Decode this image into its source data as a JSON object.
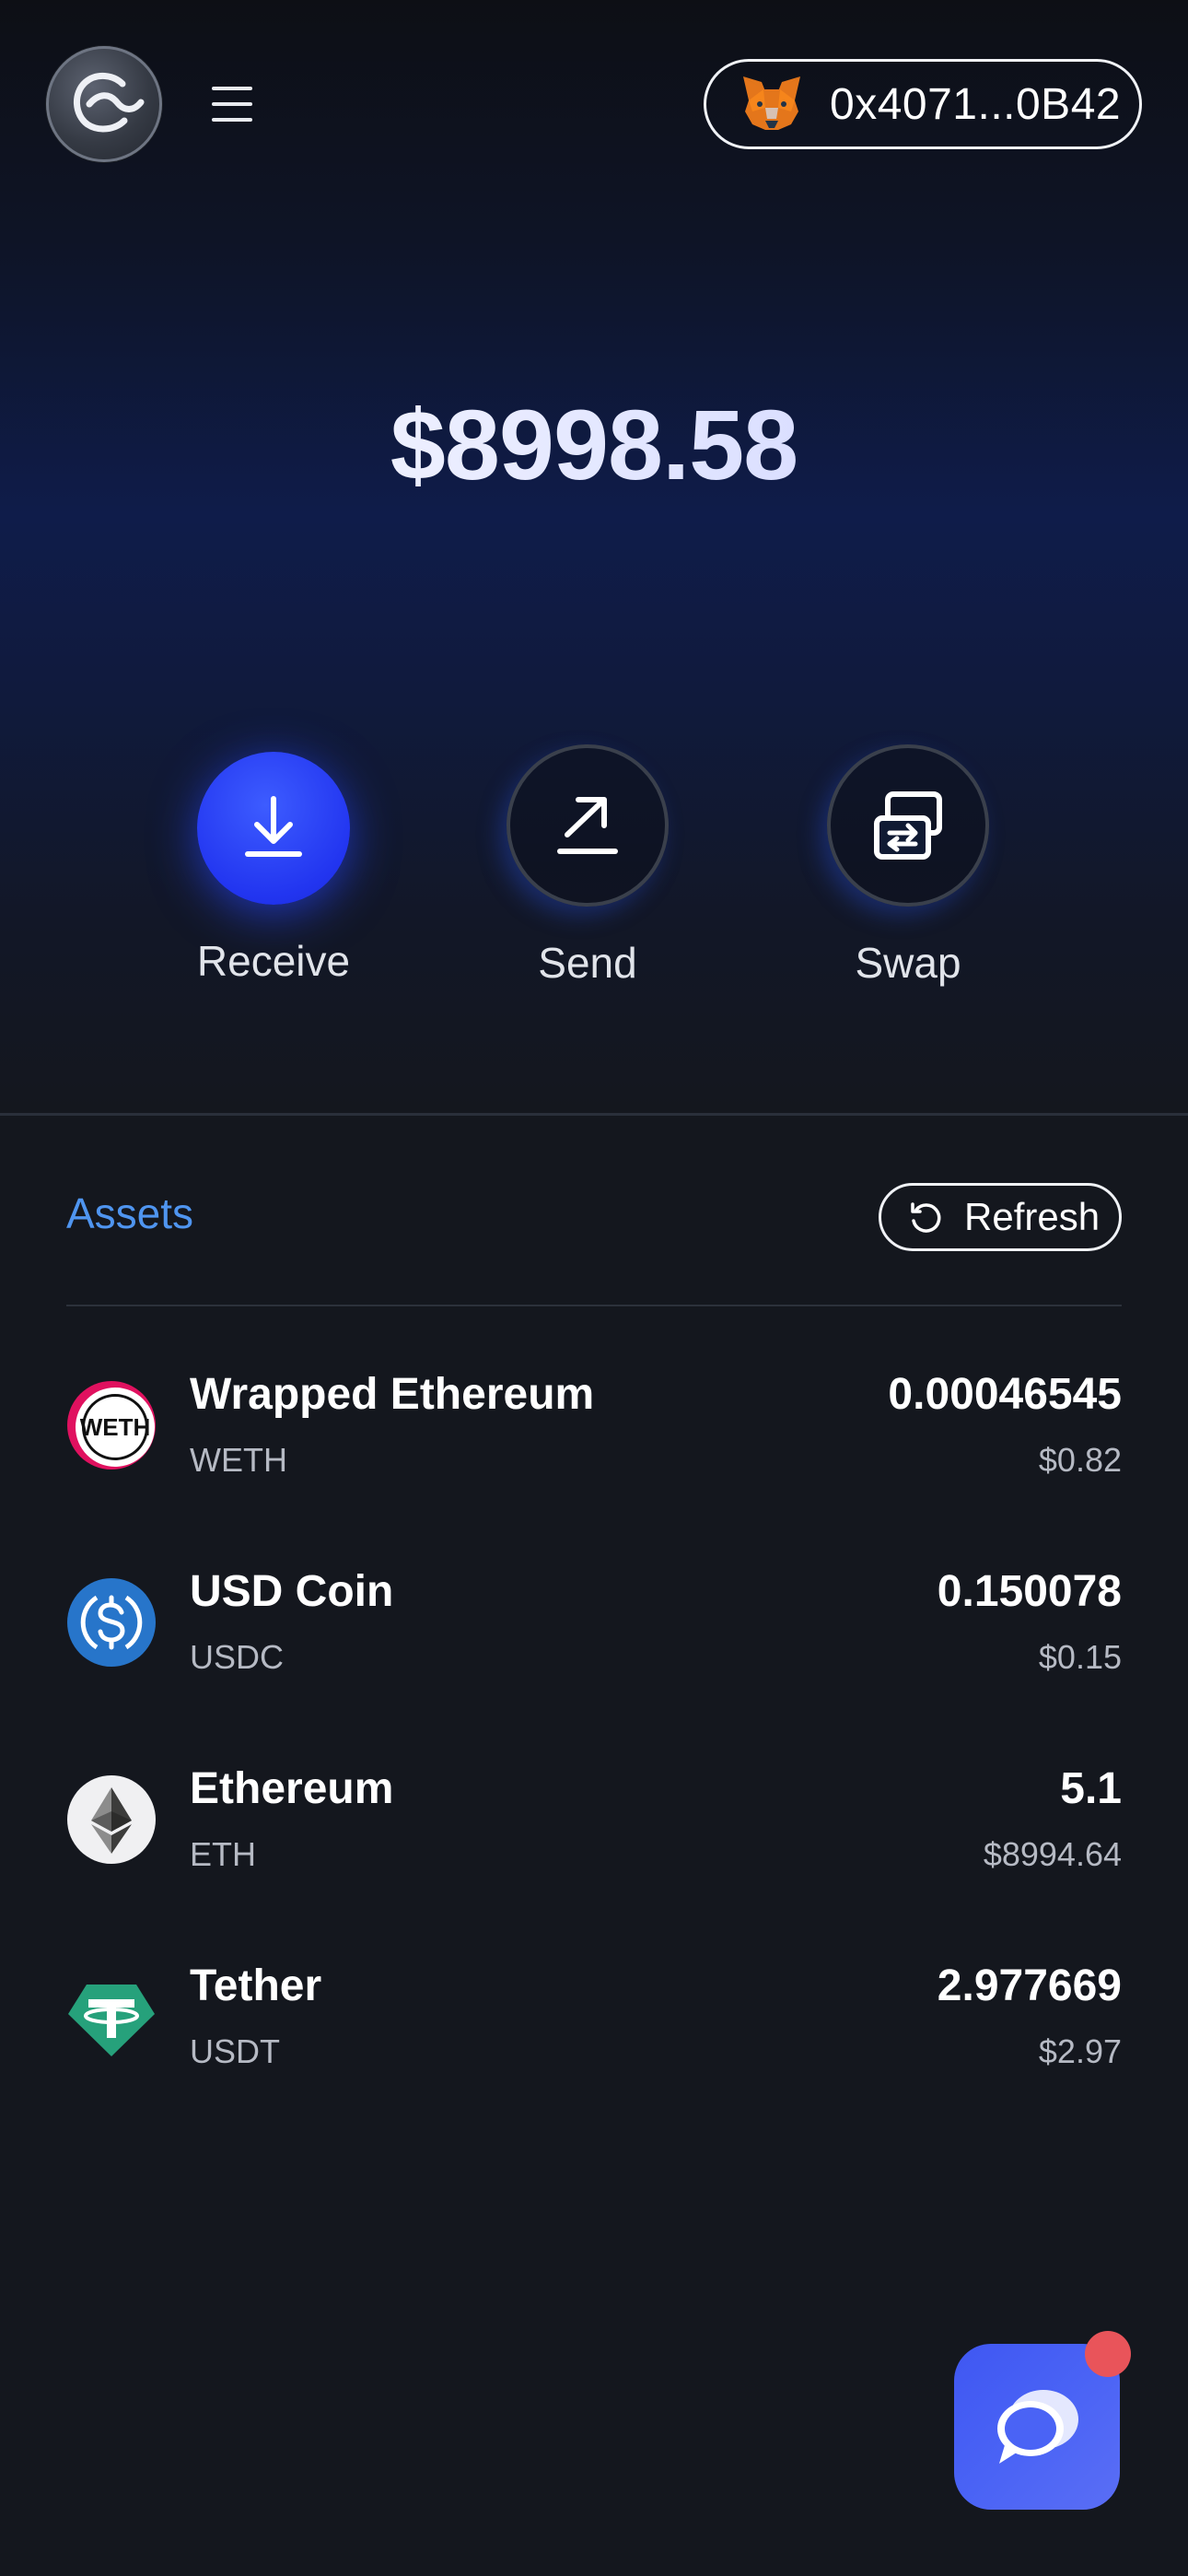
{
  "header": {
    "logo_icon": "celo-style-logo-icon",
    "menu_icon": "hamburger-menu-icon",
    "wallet_icon": "metamask-fox-icon",
    "wallet_address": "0x4071...0B42"
  },
  "balance": {
    "total": "$8998.58"
  },
  "actions": [
    {
      "label": "Receive",
      "icon": "download-arrow-icon"
    },
    {
      "label": "Send",
      "icon": "send-arrow-icon"
    },
    {
      "label": "Swap",
      "icon": "swap-arrows-icon"
    }
  ],
  "assets": {
    "title": "Assets",
    "refresh_label": "Refresh",
    "refresh_icon": "refresh-icon",
    "items": [
      {
        "name": "Wrapped Ethereum",
        "symbol": "WETH",
        "amount": "0.00046545",
        "value": "$0.82",
        "icon": "weth-icon",
        "icon_text": "WETH"
      },
      {
        "name": "USD Coin",
        "symbol": "USDC",
        "amount": "0.150078",
        "value": "$0.15",
        "icon": "usdc-icon"
      },
      {
        "name": "Ethereum",
        "symbol": "ETH",
        "amount": "5.1",
        "value": "$8994.64",
        "icon": "eth-icon"
      },
      {
        "name": "Tether",
        "symbol": "USDT",
        "amount": "2.977669",
        "value": "$2.97",
        "icon": "usdt-icon"
      }
    ]
  },
  "support": {
    "icon": "chat-bubbles-icon",
    "has_notification": true
  },
  "colors": {
    "accent_blue": "#2235f0",
    "assets_title": "#4f95f0",
    "chat_button": "#4a63f5",
    "badge_red": "#e9545a",
    "usdc_blue": "#2775ca",
    "usdt_teal": "#26a17b"
  }
}
